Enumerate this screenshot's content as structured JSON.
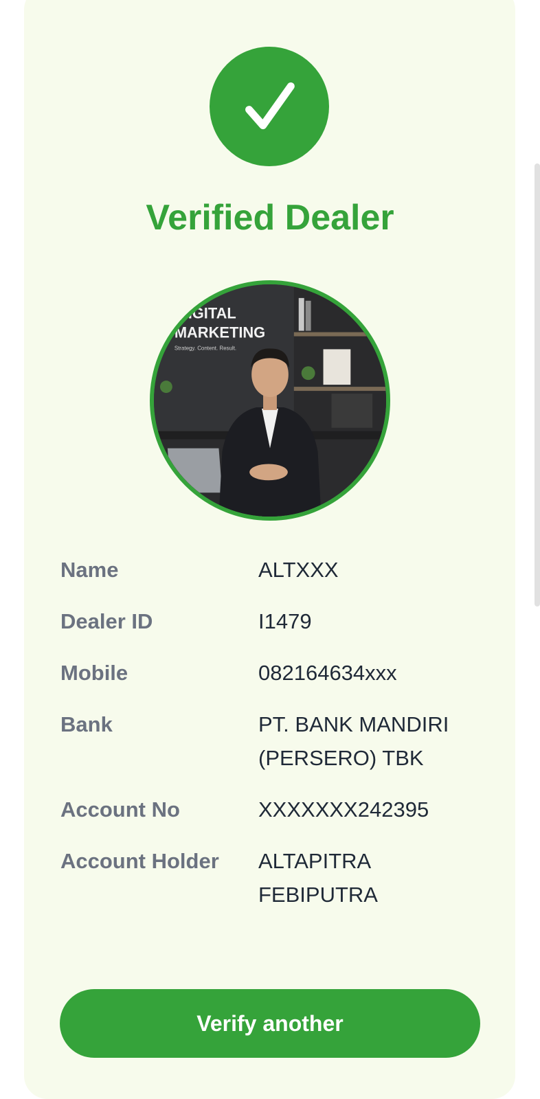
{
  "header": {
    "title": "Verified Dealer"
  },
  "icons": {
    "status": "check-icon",
    "avatar": "dealer-photo"
  },
  "photo_text": {
    "sign_line1": "IGITAL",
    "sign_line2": "MARKETING",
    "sign_tagline": "Strategy. Content. Result."
  },
  "details": [
    {
      "label": "Name",
      "value": "ALTXXX"
    },
    {
      "label": "Dealer ID",
      "value": "I1479"
    },
    {
      "label": "Mobile",
      "value": "082164634xxx"
    },
    {
      "label": "Bank",
      "value": "PT. BANK MANDIRI (PERSERO) TBK"
    },
    {
      "label": "Account No",
      "value": "XXXXXXX242395"
    },
    {
      "label": "Account Holder",
      "value": "ALTAPITRA FEBIPUTRA"
    }
  ],
  "actions": {
    "verify_another_label": "Verify another"
  },
  "colors": {
    "accent": "#35a33a",
    "card_background": "#f7fbec",
    "label_text": "#6b7280",
    "value_text": "#1f2937"
  }
}
